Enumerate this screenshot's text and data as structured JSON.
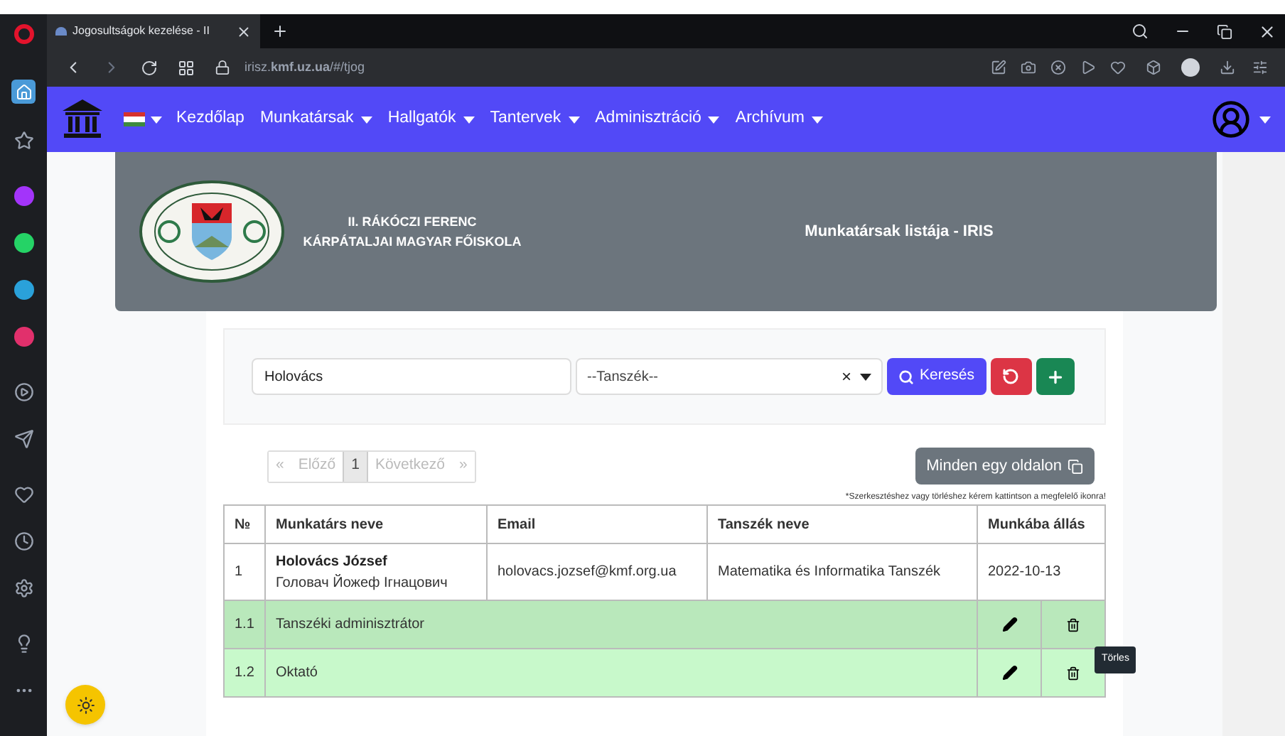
{
  "browser": {
    "tab_title": "Jogosultságok kezelése - II",
    "url": "irisz.**kmf.uz.ua**/#/tjog"
  },
  "navbar": {
    "items": [
      {
        "label": "Kezdőlap",
        "dropdown": false
      },
      {
        "label": "Munkatársak",
        "dropdown": true
      },
      {
        "label": "Hallgatók",
        "dropdown": true
      },
      {
        "label": "Tantervek",
        "dropdown": true
      },
      {
        "label": "Adminisztráció",
        "dropdown": true
      },
      {
        "label": "Archívum",
        "dropdown": true
      }
    ]
  },
  "header": {
    "school_name": [
      "II. RÁKÓCZI FERENC",
      "KÁRPÁTALJAI MAGYAR FŐISKOLA"
    ],
    "page_title": "Munkatársak listája - IRIS"
  },
  "search": {
    "value": "Holovács",
    "department_placeholder": "--Tanszék--",
    "clear": "×",
    "search_button": "Keresés"
  },
  "pagination": [
    {
      "label": "«",
      "selected": false
    },
    {
      "label": "Előző",
      "selected": false
    },
    {
      "label": "1",
      "selected": true
    },
    {
      "label": "Következő",
      "selected": false
    },
    {
      "label": "»",
      "selected": false
    }
  ],
  "show_all_button": "Minden egy oldalon",
  "note": "*Szerkesztéshez vagy törléshez kérem kattintson a megfelelő ikonra!",
  "table": {
    "columns": [
      "№",
      "Munkatárs neve",
      "Email",
      "Tanszék neve",
      "Munkába állás"
    ],
    "rows": [
      {
        "kind": "person",
        "number": "1",
        "name": "Holovács József",
        "name_cyrillic": "Головач Йожеф Ігнацович",
        "email": "holovacs.jozsef@kmf.org.ua",
        "department": "Matematika és Informatika Tanszék",
        "start_date": "2022-10-13"
      },
      {
        "kind": "role",
        "number": "1.1",
        "role": "Tanszéki adminisztrátor",
        "highlighted": true
      },
      {
        "kind": "role",
        "number": "1.2",
        "role": "Oktató",
        "highlighted": false
      }
    ]
  },
  "tooltip": "Törles"
}
